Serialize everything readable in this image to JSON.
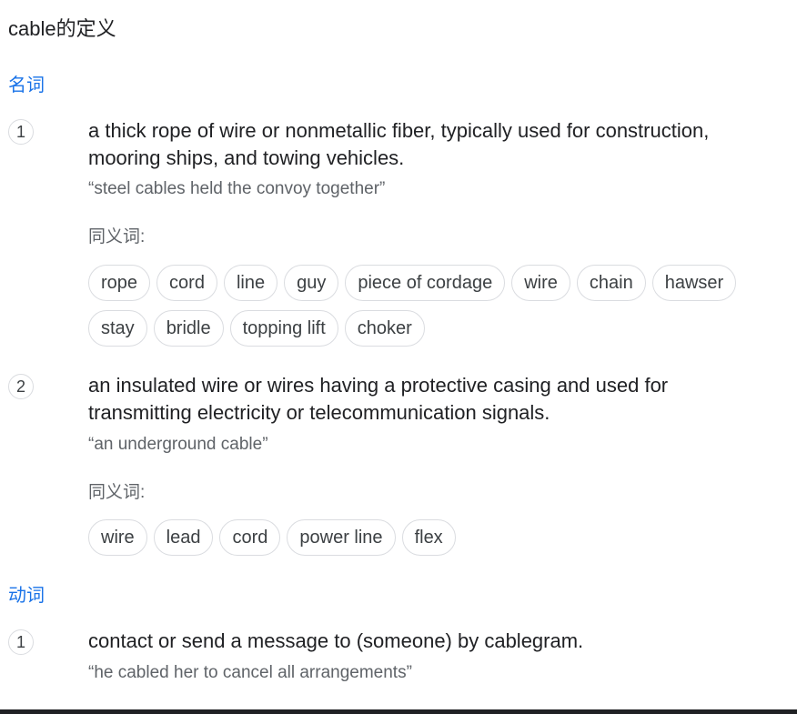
{
  "title": "cable的定义",
  "entries": [
    {
      "pos": "名词",
      "senses": [
        {
          "number": "1",
          "definition": "a thick rope of wire or nonmetallic fiber, typically used for construction, mooring ships, and towing vehicles.",
          "example": "“steel cables held the convoy together”",
          "synonyms_label": "同义词:",
          "synonyms": [
            "rope",
            "cord",
            "line",
            "guy",
            "piece of cordage",
            "wire",
            "chain",
            "hawser",
            "stay",
            "bridle",
            "topping lift",
            "choker"
          ]
        },
        {
          "number": "2",
          "definition": "an insulated wire or wires having a protective casing and used for transmitting electricity or telecommunication signals.",
          "example": "“an underground cable”",
          "synonyms_label": "同义词:",
          "synonyms": [
            "wire",
            "lead",
            "cord",
            "power line",
            "flex"
          ]
        }
      ]
    },
    {
      "pos": "动词",
      "senses": [
        {
          "number": "1",
          "definition": "contact or send a message to (someone) by cablegram.",
          "example": "“he cabled her to cancel all arrangements”"
        }
      ]
    }
  ]
}
